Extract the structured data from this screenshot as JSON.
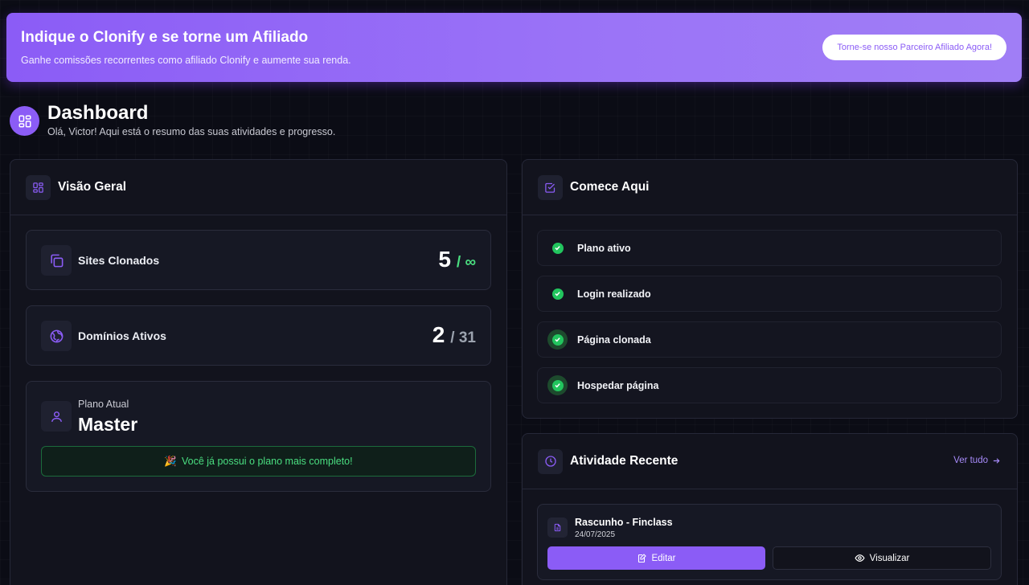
{
  "banner": {
    "title": "Indique o Clonify e se torne um Afiliado",
    "subtitle": "Ganhe comissões recorrentes como afiliado Clonify e aumente sua renda.",
    "button_label": "Torne-se nosso Parceiro Afiliado Agora!"
  },
  "header": {
    "icon": "grid-icon",
    "title": "Dashboard",
    "subtitle": "Olá, Victor! Aqui está o resumo das suas atividades e progresso."
  },
  "overview": {
    "title": "Visão Geral",
    "icon": "grid-icon",
    "sites": {
      "label": "Sites Clonados",
      "value": "5",
      "limit": "/ ∞",
      "icon": "copy-icon",
      "limit_color": "#4ade80"
    },
    "domains": {
      "label": "Domínios Ativos",
      "value": "2",
      "limit": "/ 31",
      "icon": "globe-icon",
      "limit_color": "#9ca3af"
    },
    "plan": {
      "label": "Plano Atual",
      "name": "Master",
      "icon": "user-icon",
      "note_emoji": "🎉",
      "note": "Você já possui o plano mais completo!"
    }
  },
  "getting_started": {
    "title": "Comece Aqui",
    "icon": "checkbox-icon",
    "steps": [
      {
        "label": "Plano ativo"
      },
      {
        "label": "Login realizado"
      },
      {
        "label": "Página clonada"
      },
      {
        "label": "Hospedar página"
      }
    ]
  },
  "activity": {
    "title": "Atividade Recente",
    "icon": "clock-icon",
    "see_all": "Ver tudo",
    "items": [
      {
        "title": "Rascunho - Finclass",
        "date": "24/07/2025",
        "edit_label": "Editar",
        "view_label": "Visualizar"
      }
    ]
  },
  "colors": {
    "accent": "#8b5cf6",
    "success": "#22c55e",
    "background": "#0b0c15"
  }
}
